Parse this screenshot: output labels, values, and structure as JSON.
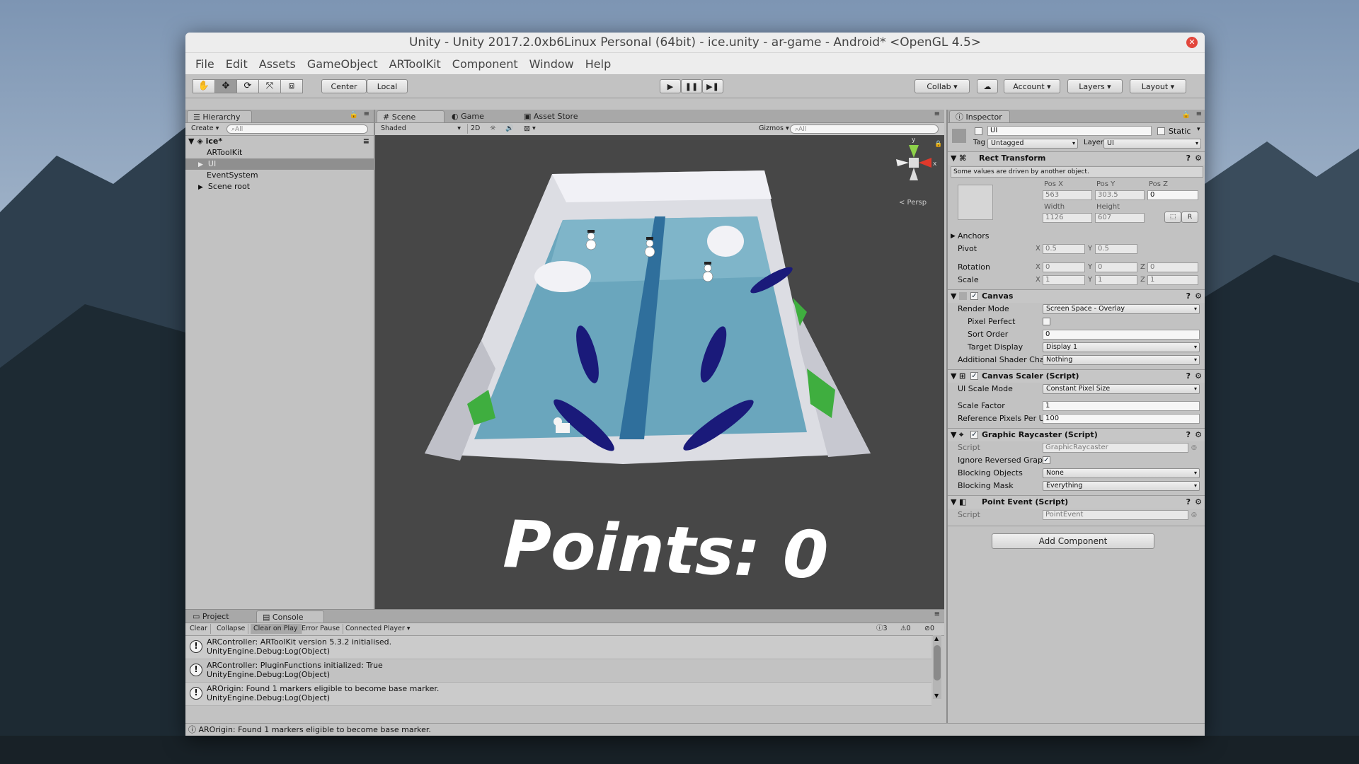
{
  "window": {
    "title": "Unity - Unity 2017.2.0xb6Linux Personal (64bit) - ice.unity - ar-game - Android* <OpenGL 4.5>"
  },
  "menu": [
    "File",
    "Edit",
    "Assets",
    "GameObject",
    "ARToolKit",
    "Component",
    "Window",
    "Help"
  ],
  "toolbar": {
    "center_label": "Center",
    "local_label": "Local",
    "collab_label": "Collab",
    "account_label": "Account",
    "layers_label": "Layers",
    "layout_label": "Layout"
  },
  "hierarchy": {
    "tab": "Hierarchy",
    "create": "Create",
    "search_placeholder": "All",
    "scene_name": "ice*",
    "items": [
      "ARToolKit",
      "UI",
      "EventSystem",
      "Scene root"
    ]
  },
  "scene": {
    "tabs": [
      "Scene",
      "Game",
      "Asset Store"
    ],
    "shading": "Shaded",
    "mode_2d": "2D",
    "gizmos": "Gizmos",
    "search_placeholder": "All",
    "persp_label": "< Persp",
    "gizmo_axes": {
      "y": "y",
      "x": "x"
    },
    "overlay_text": "Points: 0"
  },
  "inspector": {
    "tab": "Inspector",
    "object_name": "UI",
    "static_label": "Static",
    "tag_label": "Tag",
    "tag_value": "Untagged",
    "layer_label": "Layer",
    "layer_value": "UI",
    "rect_transform": {
      "title": "Rect Transform",
      "note": "Some values are driven by another object.",
      "pos_x_label": "Pos X",
      "pos_y_label": "Pos Y",
      "pos_z_label": "Pos Z",
      "pos_x": "563",
      "pos_y": "303.5",
      "pos_z": "0",
      "width_label": "Width",
      "height_label": "Height",
      "width": "1126",
      "height": "607",
      "r_button": "R",
      "anchors_label": "Anchors",
      "pivot_label": "Pivot",
      "pivot_x": "0.5",
      "pivot_y": "0.5",
      "rotation_label": "Rotation",
      "rot_x": "0",
      "rot_y": "0",
      "rot_z": "0",
      "scale_label": "Scale",
      "scale_x": "1",
      "scale_y": "1",
      "scale_z": "1",
      "axis_x": "X",
      "axis_y": "Y",
      "axis_z": "Z"
    },
    "canvas": {
      "title": "Canvas",
      "render_mode_label": "Render Mode",
      "render_mode": "Screen Space - Overlay",
      "pixel_perfect_label": "Pixel Perfect",
      "sort_order_label": "Sort Order",
      "sort_order": "0",
      "target_display_label": "Target Display",
      "target_display": "Display 1",
      "shader_label": "Additional Shader Cha",
      "shader_value": "Nothing"
    },
    "canvas_scaler": {
      "title": "Canvas Scaler (Script)",
      "ui_scale_label": "UI Scale Mode",
      "ui_scale_value": "Constant Pixel Size",
      "scale_factor_label": "Scale Factor",
      "scale_factor": "1",
      "ref_pixels_label": "Reference Pixels Per Ui",
      "ref_pixels": "100"
    },
    "graphic_raycaster": {
      "title": "Graphic Raycaster (Script)",
      "script_label": "Script",
      "script_value": "GraphicRaycaster",
      "ignore_label": "Ignore Reversed Graph",
      "blocking_objects_label": "Blocking Objects",
      "blocking_objects": "None",
      "blocking_mask_label": "Blocking Mask",
      "blocking_mask": "Everything"
    },
    "point_event": {
      "title": "Point Event (Script)",
      "script_label": "Script",
      "script_value": "PointEvent"
    },
    "add_component": "Add Component"
  },
  "console": {
    "tabs": [
      "Project",
      "Console"
    ],
    "buttons": [
      "Clear",
      "Collapse",
      "Clear on Play",
      "Error Pause",
      "Connected Player"
    ],
    "counts": {
      "info": "3",
      "warn": "0",
      "error": "0"
    },
    "messages": [
      {
        "line1": "ARController: ARToolKit version 5.3.2 initialised.",
        "line2": "UnityEngine.Debug:Log(Object)"
      },
      {
        "line1": "ARController: PluginFunctions initialized: True",
        "line2": "UnityEngine.Debug:Log(Object)"
      },
      {
        "line1": "AROrigin: Found 1 markers eligible to become base marker.",
        "line2": "UnityEngine.Debug:Log(Object)"
      }
    ]
  },
  "status": {
    "text": "AROrigin: Found 1 markers eligible to become base marker."
  },
  "colors": {
    "ice": "#6aa6bd",
    "river": "#2f6f9c",
    "crystal": "#1a1a7a",
    "grass": "#3fae3f",
    "snow": "#e9e9ee"
  }
}
